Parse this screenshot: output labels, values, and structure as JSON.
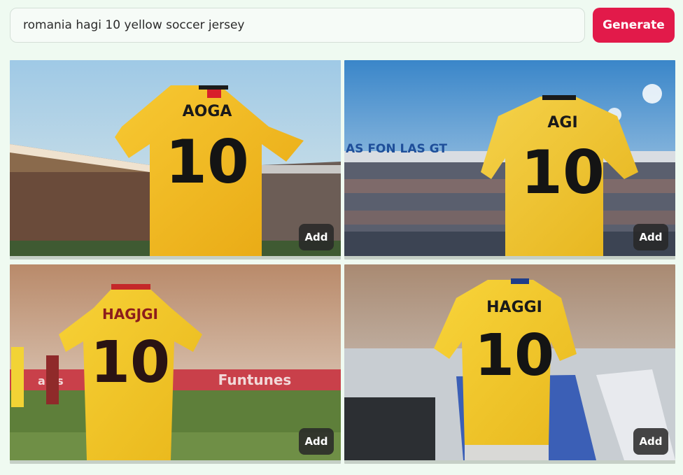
{
  "search": {
    "query": "romania hagi 10 yellow soccer jersey"
  },
  "generate_label": "Generate",
  "results": [
    {
      "jersey_name": "AOGA",
      "jersey_number": "10",
      "add_label": "Add"
    },
    {
      "jersey_name": "AGI",
      "jersey_number": "10",
      "stadium_banner": "AS FON LAS GT",
      "add_label": "Add"
    },
    {
      "jersey_name": "HAGJGI",
      "jersey_number": "10",
      "board_text": "Funtunes",
      "board_text_left": "ales",
      "add_label": "Add"
    },
    {
      "jersey_name": "HAGGI",
      "jersey_number": "10",
      "add_label": "Add"
    }
  ],
  "colors": {
    "page_bg": "#effaf1",
    "accent": "#e21a4a",
    "jersey_yellow": "#f5c21f"
  }
}
